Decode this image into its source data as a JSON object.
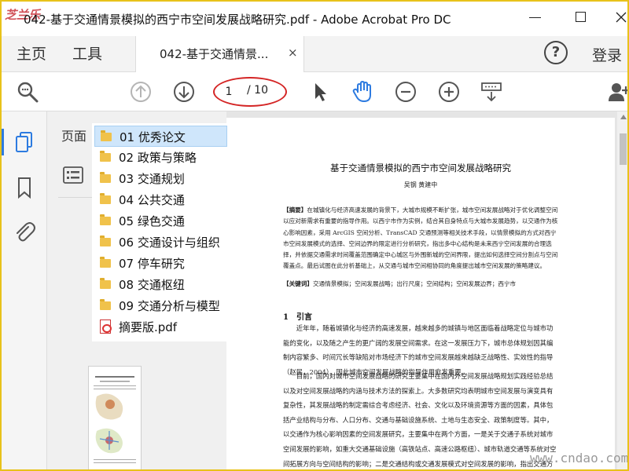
{
  "window": {
    "logo_text": "芝兰乐",
    "title": "042-基于交通情景模拟的西宁市空间发展战略研究.pdf - Adobe Acrobat Pro DC",
    "close_glyph": "✕"
  },
  "menu": {
    "home": "主页",
    "tools": "工具",
    "tab_label": "042-基于交通情景...",
    "tab_close": "×",
    "help": "?",
    "login": "登录"
  },
  "toolbar": {
    "current_page": "1",
    "total_pages": "/ 10",
    "icons": [
      "search-icon",
      "prev-page-icon",
      "next-page-icon",
      "select-arrow-icon",
      "hand-tool-icon",
      "zoom-out-icon",
      "zoom-in-icon",
      "page-display-icon",
      "share-user-icon"
    ],
    "highlight_color": "#d42424"
  },
  "sidebar": {
    "panel_title": "页面",
    "rail_icons": [
      "pages-icon",
      "bookmark-icon",
      "attachment-icon"
    ],
    "accent": "#2d7be0"
  },
  "folders": [
    {
      "label": "01 优秀论文",
      "type": "folder",
      "selected": true
    },
    {
      "label": "02 政策与策略",
      "type": "folder"
    },
    {
      "label": "03 交通规划",
      "type": "folder"
    },
    {
      "label": "04 公共交通",
      "type": "folder"
    },
    {
      "label": "05 绿色交通",
      "type": "folder"
    },
    {
      "label": "06 交通设计与组织",
      "type": "folder"
    },
    {
      "label": "07 停车研究",
      "type": "folder"
    },
    {
      "label": "08 交通枢纽",
      "type": "folder"
    },
    {
      "label": "09 交通分析与模型",
      "type": "folder"
    },
    {
      "label": "摘要版.pdf",
      "type": "pdf"
    }
  ],
  "document": {
    "title": "基于交通情景模拟的西宁市空间发展战略研究",
    "authors": "吴钢 黄建中",
    "abstract_label": "【摘要】",
    "abstract": "在城镇化与经济高速发展的背景下，大城市规模不断扩张，城市空间发展战略对于优化调整空间以应对新需求有重要的指导作用。以西宁市作为实例，结合其自身特点与大城市发展趋势，以交通作为核心影响因素，采用 ArcGIS 空间分析、TransCAD 交通预测等相关技术手段，以情景模拟的方式对西宁市空间发展模式的选择、空间边界的限定进行分析研究，指出多中心结构是未来西宁空间发展的合理选择，并依据交通需求时间覆盖范围确定中心城区与外围新城的空间界限，提出如何选择空间分割点与空间覆盖点。最后试图在此分析基础上，从交通与城市空间相协同的角度提出城市空间发展的策略建议。",
    "keywords_label": "【关键词】",
    "keywords": "交通情景模拟；空间发展战略；出行尺度；空间结构；空间发展边界；西宁市",
    "section": "1　引言",
    "para1": "近年年，随着城镇化与经济的高速发展，越来越多的城镇与地区面临着战略定位与城市功能的变化，以及随之产生的更广阔的发展空间需求。在这一发展压力下，城市总体规划因其编制内容繁多、时间冗长等缺陷对市场经济下的城市空间发展越来越缺乏战略性、实效性的指导（赵民，2004），因此城市空间发展战略的指导作用愈发重要。",
    "para2": "目前，国内对城市空间发展战略的研究主要集中在国内外空间发展战略规划实践经验总结以及对空间发展战略的内涵与技术方法的探索上。大多数研究均表明城市空间发展与演变具有复杂性，其发展战略的制定需综合考虑经济、社会、文化以及环境资源等方面的因素，具体包括产业结构与分布、人口分布、交通与基础设施系统、土地与生态安全、政策制度等。其中，以交通作为核心影响因素的空间发展研究，主要集中在两个方面，一是关于交通子系统对城市空间发展的影响，如重大交通基础设施（高铁站点、高速公路枢纽）、城市轨道交通等系统对空间拓展方向与空间结构的影响；二是交通结构或交通发展模式对空间发展的影响，指出交通方式变革对城市规模扩大与城市空间结构演化有引导、支撑作用，但相关研究"
  },
  "watermark": "www.cndao.com"
}
